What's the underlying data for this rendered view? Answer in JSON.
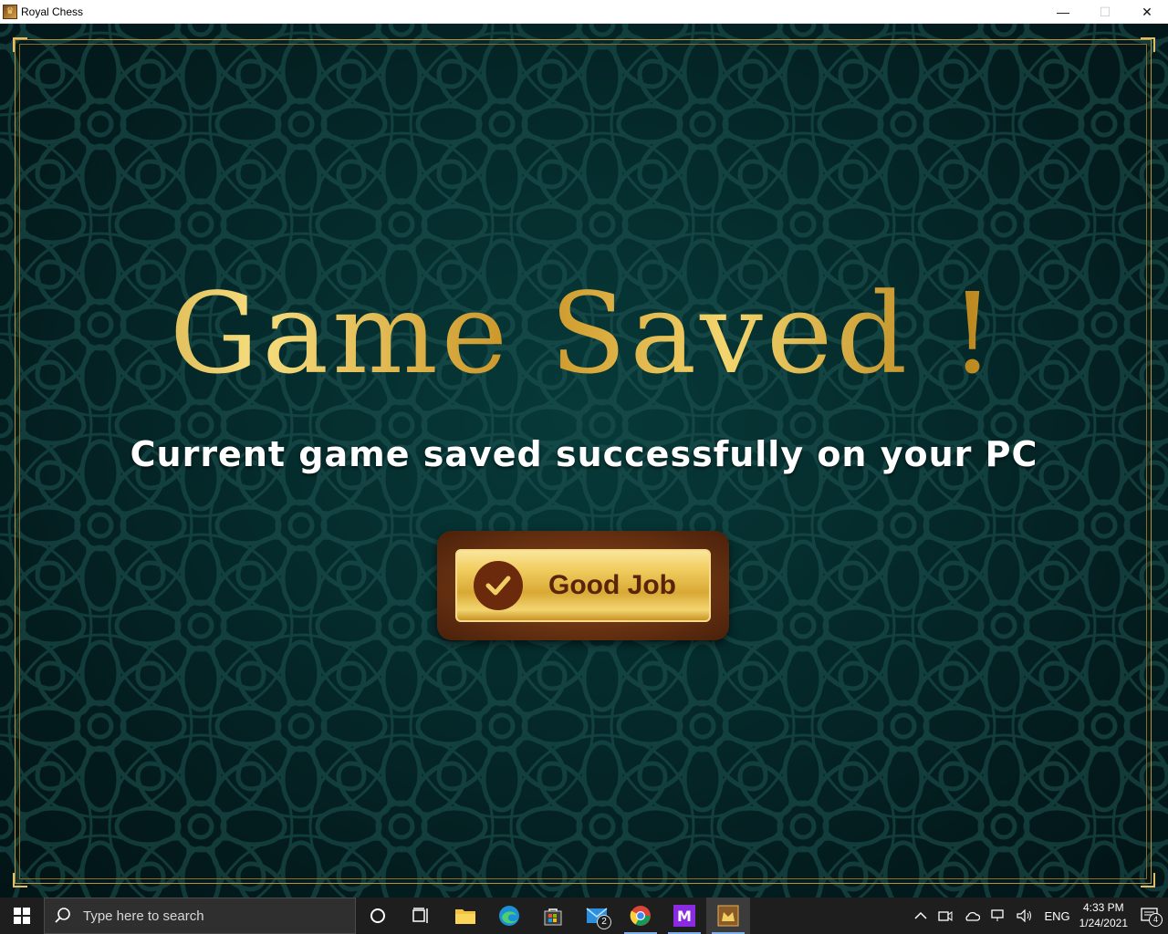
{
  "window": {
    "title": "Royal Chess",
    "minimize_glyph": "—",
    "maximize_glyph": "☐",
    "close_glyph": "✕"
  },
  "dialog": {
    "headline": "Game Saved !",
    "message": "Current game saved successfully on your PC",
    "confirm_label": "Good Job",
    "confirm_icon": "check-icon"
  },
  "taskbar": {
    "search_placeholder": "Type here to search",
    "apps": [
      {
        "name": "cortana",
        "icon": "circle-icon"
      },
      {
        "name": "task-view",
        "icon": "task-view-icon"
      },
      {
        "name": "file-explorer",
        "icon": "folder-icon"
      },
      {
        "name": "edge",
        "icon": "edge-icon"
      },
      {
        "name": "store",
        "icon": "store-icon"
      },
      {
        "name": "mail",
        "icon": "mail-icon",
        "badge": "2"
      },
      {
        "name": "chrome",
        "icon": "chrome-icon"
      },
      {
        "name": "m-app",
        "icon": "m-app-icon"
      },
      {
        "name": "royal-chess",
        "icon": "royal-chess-icon"
      }
    ],
    "tray": {
      "language": "ENG",
      "time": "4:33 PM",
      "date": "1/24/2021",
      "notifications": "4"
    }
  },
  "colors": {
    "background": "#052b2c",
    "gold": "#e6c25a",
    "button_wood": "#6a3312",
    "checkmark_circle": "#6b2a0c",
    "taskbar": "#1e1e1e"
  }
}
